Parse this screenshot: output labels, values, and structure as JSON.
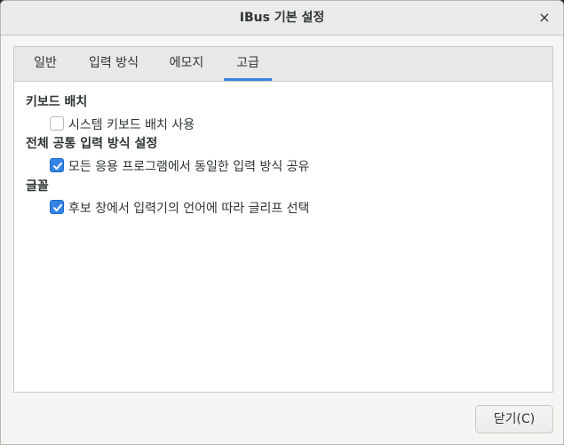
{
  "window": {
    "title": "IBus 기본 설정",
    "close_glyph": "×"
  },
  "tabs": [
    {
      "label": "일반",
      "active": false
    },
    {
      "label": "입력 방식",
      "active": false
    },
    {
      "label": "에모지",
      "active": false
    },
    {
      "label": "고급",
      "active": true
    }
  ],
  "sections": [
    {
      "title": "키보드 배치",
      "option": {
        "label": "시스템 키보드 배치 사용",
        "checked": false
      }
    },
    {
      "title": "전체 공통 입력 방식 설정",
      "option": {
        "label": "모든 응용 프로그램에서 동일한 입력 방식 공유",
        "checked": true
      }
    },
    {
      "title": "글꼴",
      "option": {
        "label": "후보 창에서 입력기의 언어에 따라 글리프 선택",
        "checked": true
      }
    }
  ],
  "footer": {
    "close_label": "닫기(C)"
  },
  "colors": {
    "accent": "#3584e4",
    "text": "#2e3436"
  }
}
